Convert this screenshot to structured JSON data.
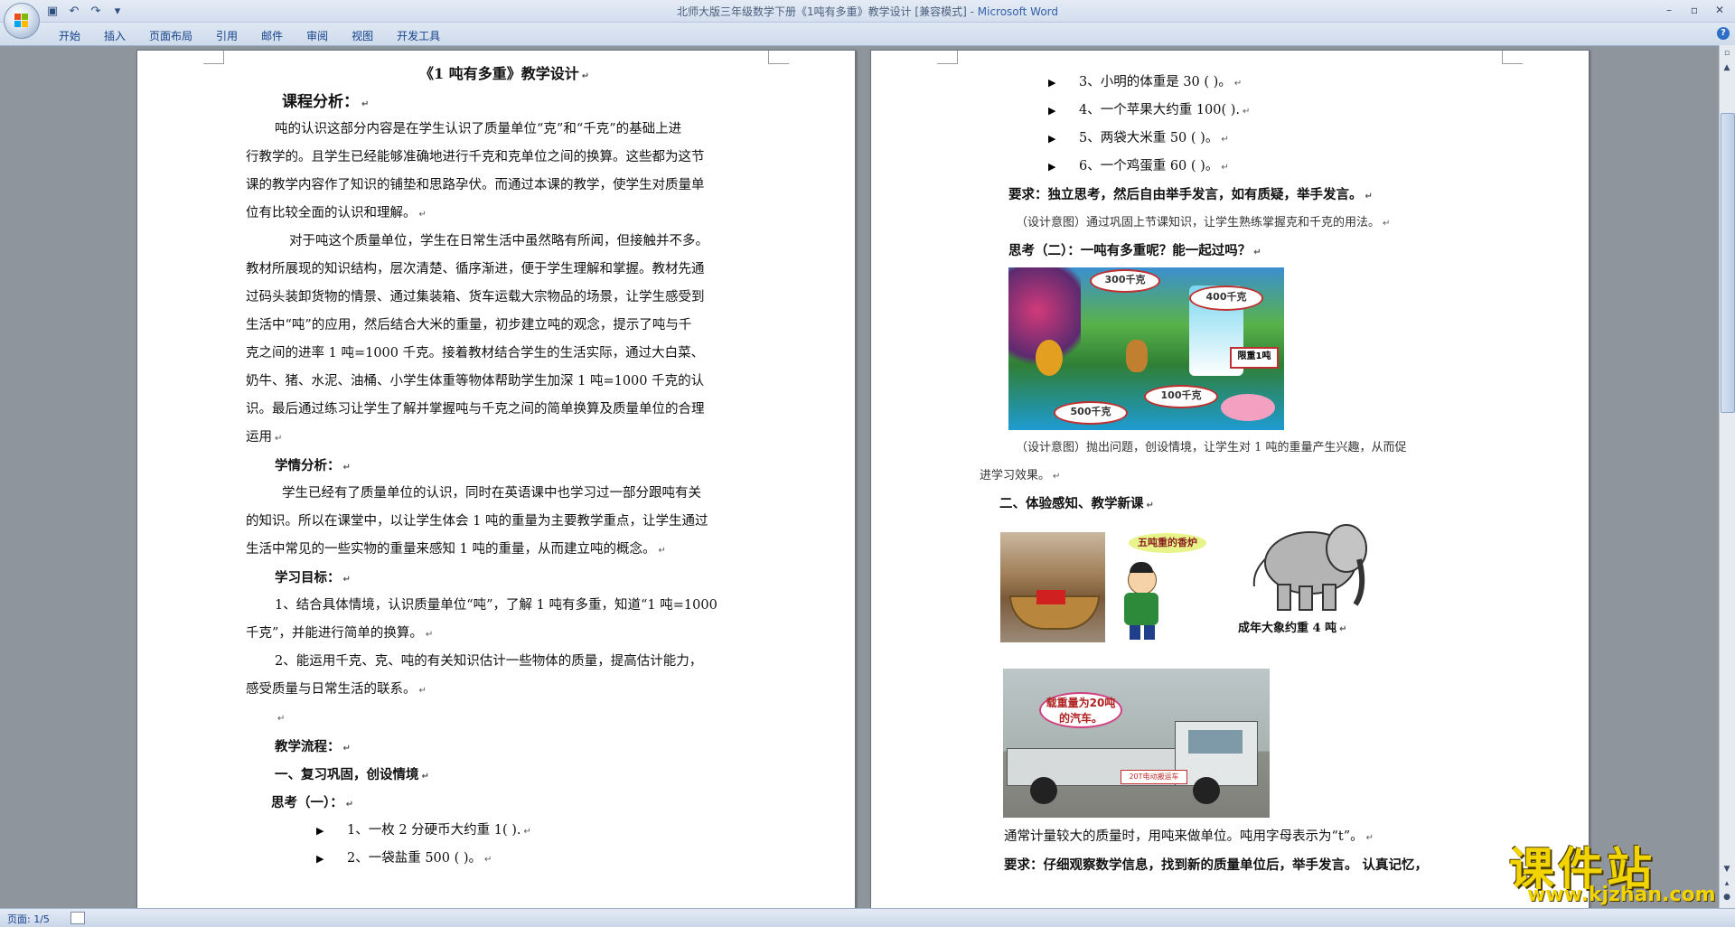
{
  "window": {
    "title_doc": "北师大版三年级数学下册《1吨有多重》教学设计 [兼容模式] - ",
    "title_app": "Microsoft Word",
    "controls": {
      "minimize": "–",
      "restore": "▫",
      "close": "✕"
    }
  },
  "qat": {
    "save_icon": "save-icon",
    "undo_icon": "undo-icon",
    "redo_icon": "redo-icon",
    "customize": "▾"
  },
  "ribbon": {
    "tabs": [
      "开始",
      "插入",
      "页面布局",
      "引用",
      "邮件",
      "审阅",
      "视图",
      "开发工具"
    ],
    "help": "?"
  },
  "page1": {
    "title": "《1 吨有多重》教学设计",
    "h_course": "课程分析：",
    "p1": [
      "吨的认识这部分内容是在学生认识了质量单位“克”和“千克”的基础上进",
      "行教学的。且学生已经能够准确地进行千克和克单位之间的换算。这些都为这节",
      "课的教学内容作了知识的铺垫和思路孕伏。而通过本课的教学，使学生对质量单",
      "位有比较全面的认识和理解。"
    ],
    "p2": [
      "对于吨这个质量单位，学生在日常生活中虽然略有所闻，但接触并不多。",
      "教材所展现的知识结构，层次清楚、循序渐进，便于学生理解和掌握。教材先通",
      "过码头装卸货物的情景、通过集装箱、货车运载大宗物品的场景，让学生感受到",
      "生活中“吨”的应用，然后结合大米的重量，初步建立吨的观念，提示了吨与千",
      "克之间的进率 1 吨=1000 千克。接着教材结合学生的生活实际，通过大白菜、",
      "奶牛、猪、水泥、油桶、小学生体重等物体帮助学生加深 1 吨=1000 千克的认",
      "识。最后通过练习让学生了解并掌握吨与千克之间的简单换算及质量单位的合理",
      "运用"
    ],
    "h_learner": "学情分析：",
    "p3": [
      "学生已经有了质量单位的认识，同时在英语课中也学习过一部分跟吨有关",
      "的知识。所以在课堂中，以让学生体会 1 吨的重量为主要教学重点，让学生通过",
      "生活中常见的一些实物的重量来感知 1 吨的重量，从而建立吨的概念。"
    ],
    "h_goals": "学习目标：",
    "goals": [
      "1、结合具体情境，认识质量单位“吨”，了解 1 吨有多重，知道“1 吨=1000",
      "千克”，并能进行简单的换算。",
      "2、能运用千克、克、吨的有关知识估计一些物体的质量，提高估计能力，",
      "感受质量与日常生活的联系。"
    ],
    "h_flow": "教学流程：",
    "h_section1": "一、复习巩固，创设情境",
    "h_think1": "思考（一）：",
    "items": [
      "1、一枚 2 分硬币大约重 1(        ).",
      "2、一袋盐重 500 (        )。"
    ]
  },
  "page2": {
    "items": [
      "3、小明的体重是 30 (        )。",
      "4、一个苹果大约重 100(        ).",
      "5、两袋大米重 50 (        )。",
      "6、一个鸡蛋重 60 (        )。"
    ],
    "req1": "要求：独立思考，然后自由举手发言，如有质疑，举手发言。",
    "design1": "（设计意图）通过巩固上节课知识，让学生熟练掌握克和千克的用法。",
    "think2": "思考（二）：一吨有多重呢？能一起过吗？",
    "bubbles": [
      "300千克",
      "400千克",
      "限重1吨",
      "100千克",
      "500千克"
    ],
    "design2a": "（设计意图）抛出问题，创设情境，让学生对 1 吨的重量产生兴趣，从而促",
    "design2b": "进学习效果。",
    "section2": "二、体验感知、教学新课",
    "censer_bubble": "五吨重的香炉",
    "elephant_caption": "成年大象约重 4 吨",
    "truck_bubble_1": "载重量为20吨",
    "truck_bubble_2": "的汽车。",
    "truck_sign": "20T电动搬运车",
    "note": "通常计量较大的质量时，用吨来做单位。吨用字母表示为“t”。",
    "req2": "要求：仔细观察数学信息，找到新的质量单位后，举手发言。 认真记忆，"
  },
  "status": {
    "page": "页面: 1/5"
  },
  "watermark": {
    "title": "课件站",
    "url": "www.kjzhan.com"
  }
}
